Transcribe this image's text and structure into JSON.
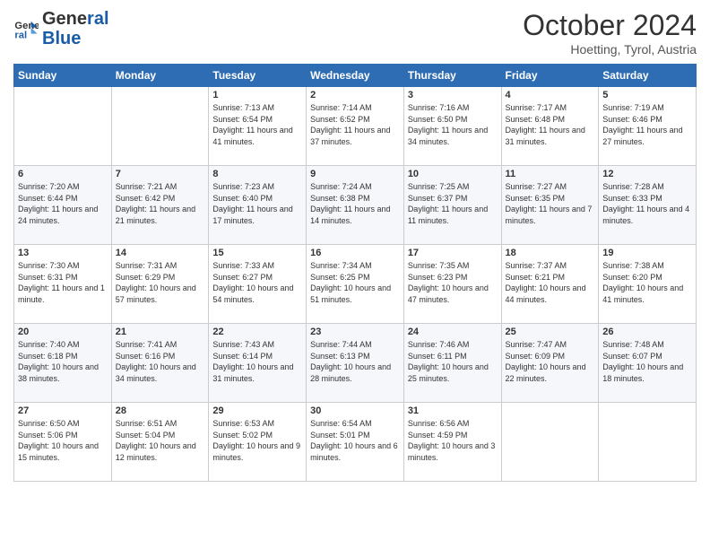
{
  "header": {
    "logo_line1": "General",
    "logo_line2": "Blue",
    "month": "October 2024",
    "location": "Hoetting, Tyrol, Austria"
  },
  "days_of_week": [
    "Sunday",
    "Monday",
    "Tuesday",
    "Wednesday",
    "Thursday",
    "Friday",
    "Saturday"
  ],
  "weeks": [
    [
      {
        "day": "",
        "info": ""
      },
      {
        "day": "",
        "info": ""
      },
      {
        "day": "1",
        "info": "Sunrise: 7:13 AM\nSunset: 6:54 PM\nDaylight: 11 hours and 41 minutes."
      },
      {
        "day": "2",
        "info": "Sunrise: 7:14 AM\nSunset: 6:52 PM\nDaylight: 11 hours and 37 minutes."
      },
      {
        "day": "3",
        "info": "Sunrise: 7:16 AM\nSunset: 6:50 PM\nDaylight: 11 hours and 34 minutes."
      },
      {
        "day": "4",
        "info": "Sunrise: 7:17 AM\nSunset: 6:48 PM\nDaylight: 11 hours and 31 minutes."
      },
      {
        "day": "5",
        "info": "Sunrise: 7:19 AM\nSunset: 6:46 PM\nDaylight: 11 hours and 27 minutes."
      }
    ],
    [
      {
        "day": "6",
        "info": "Sunrise: 7:20 AM\nSunset: 6:44 PM\nDaylight: 11 hours and 24 minutes."
      },
      {
        "day": "7",
        "info": "Sunrise: 7:21 AM\nSunset: 6:42 PM\nDaylight: 11 hours and 21 minutes."
      },
      {
        "day": "8",
        "info": "Sunrise: 7:23 AM\nSunset: 6:40 PM\nDaylight: 11 hours and 17 minutes."
      },
      {
        "day": "9",
        "info": "Sunrise: 7:24 AM\nSunset: 6:38 PM\nDaylight: 11 hours and 14 minutes."
      },
      {
        "day": "10",
        "info": "Sunrise: 7:25 AM\nSunset: 6:37 PM\nDaylight: 11 hours and 11 minutes."
      },
      {
        "day": "11",
        "info": "Sunrise: 7:27 AM\nSunset: 6:35 PM\nDaylight: 11 hours and 7 minutes."
      },
      {
        "day": "12",
        "info": "Sunrise: 7:28 AM\nSunset: 6:33 PM\nDaylight: 11 hours and 4 minutes."
      }
    ],
    [
      {
        "day": "13",
        "info": "Sunrise: 7:30 AM\nSunset: 6:31 PM\nDaylight: 11 hours and 1 minute."
      },
      {
        "day": "14",
        "info": "Sunrise: 7:31 AM\nSunset: 6:29 PM\nDaylight: 10 hours and 57 minutes."
      },
      {
        "day": "15",
        "info": "Sunrise: 7:33 AM\nSunset: 6:27 PM\nDaylight: 10 hours and 54 minutes."
      },
      {
        "day": "16",
        "info": "Sunrise: 7:34 AM\nSunset: 6:25 PM\nDaylight: 10 hours and 51 minutes."
      },
      {
        "day": "17",
        "info": "Sunrise: 7:35 AM\nSunset: 6:23 PM\nDaylight: 10 hours and 47 minutes."
      },
      {
        "day": "18",
        "info": "Sunrise: 7:37 AM\nSunset: 6:21 PM\nDaylight: 10 hours and 44 minutes."
      },
      {
        "day": "19",
        "info": "Sunrise: 7:38 AM\nSunset: 6:20 PM\nDaylight: 10 hours and 41 minutes."
      }
    ],
    [
      {
        "day": "20",
        "info": "Sunrise: 7:40 AM\nSunset: 6:18 PM\nDaylight: 10 hours and 38 minutes."
      },
      {
        "day": "21",
        "info": "Sunrise: 7:41 AM\nSunset: 6:16 PM\nDaylight: 10 hours and 34 minutes."
      },
      {
        "day": "22",
        "info": "Sunrise: 7:43 AM\nSunset: 6:14 PM\nDaylight: 10 hours and 31 minutes."
      },
      {
        "day": "23",
        "info": "Sunrise: 7:44 AM\nSunset: 6:13 PM\nDaylight: 10 hours and 28 minutes."
      },
      {
        "day": "24",
        "info": "Sunrise: 7:46 AM\nSunset: 6:11 PM\nDaylight: 10 hours and 25 minutes."
      },
      {
        "day": "25",
        "info": "Sunrise: 7:47 AM\nSunset: 6:09 PM\nDaylight: 10 hours and 22 minutes."
      },
      {
        "day": "26",
        "info": "Sunrise: 7:48 AM\nSunset: 6:07 PM\nDaylight: 10 hours and 18 minutes."
      }
    ],
    [
      {
        "day": "27",
        "info": "Sunrise: 6:50 AM\nSunset: 5:06 PM\nDaylight: 10 hours and 15 minutes."
      },
      {
        "day": "28",
        "info": "Sunrise: 6:51 AM\nSunset: 5:04 PM\nDaylight: 10 hours and 12 minutes."
      },
      {
        "day": "29",
        "info": "Sunrise: 6:53 AM\nSunset: 5:02 PM\nDaylight: 10 hours and 9 minutes."
      },
      {
        "day": "30",
        "info": "Sunrise: 6:54 AM\nSunset: 5:01 PM\nDaylight: 10 hours and 6 minutes."
      },
      {
        "day": "31",
        "info": "Sunrise: 6:56 AM\nSunset: 4:59 PM\nDaylight: 10 hours and 3 minutes."
      },
      {
        "day": "",
        "info": ""
      },
      {
        "day": "",
        "info": ""
      }
    ]
  ]
}
